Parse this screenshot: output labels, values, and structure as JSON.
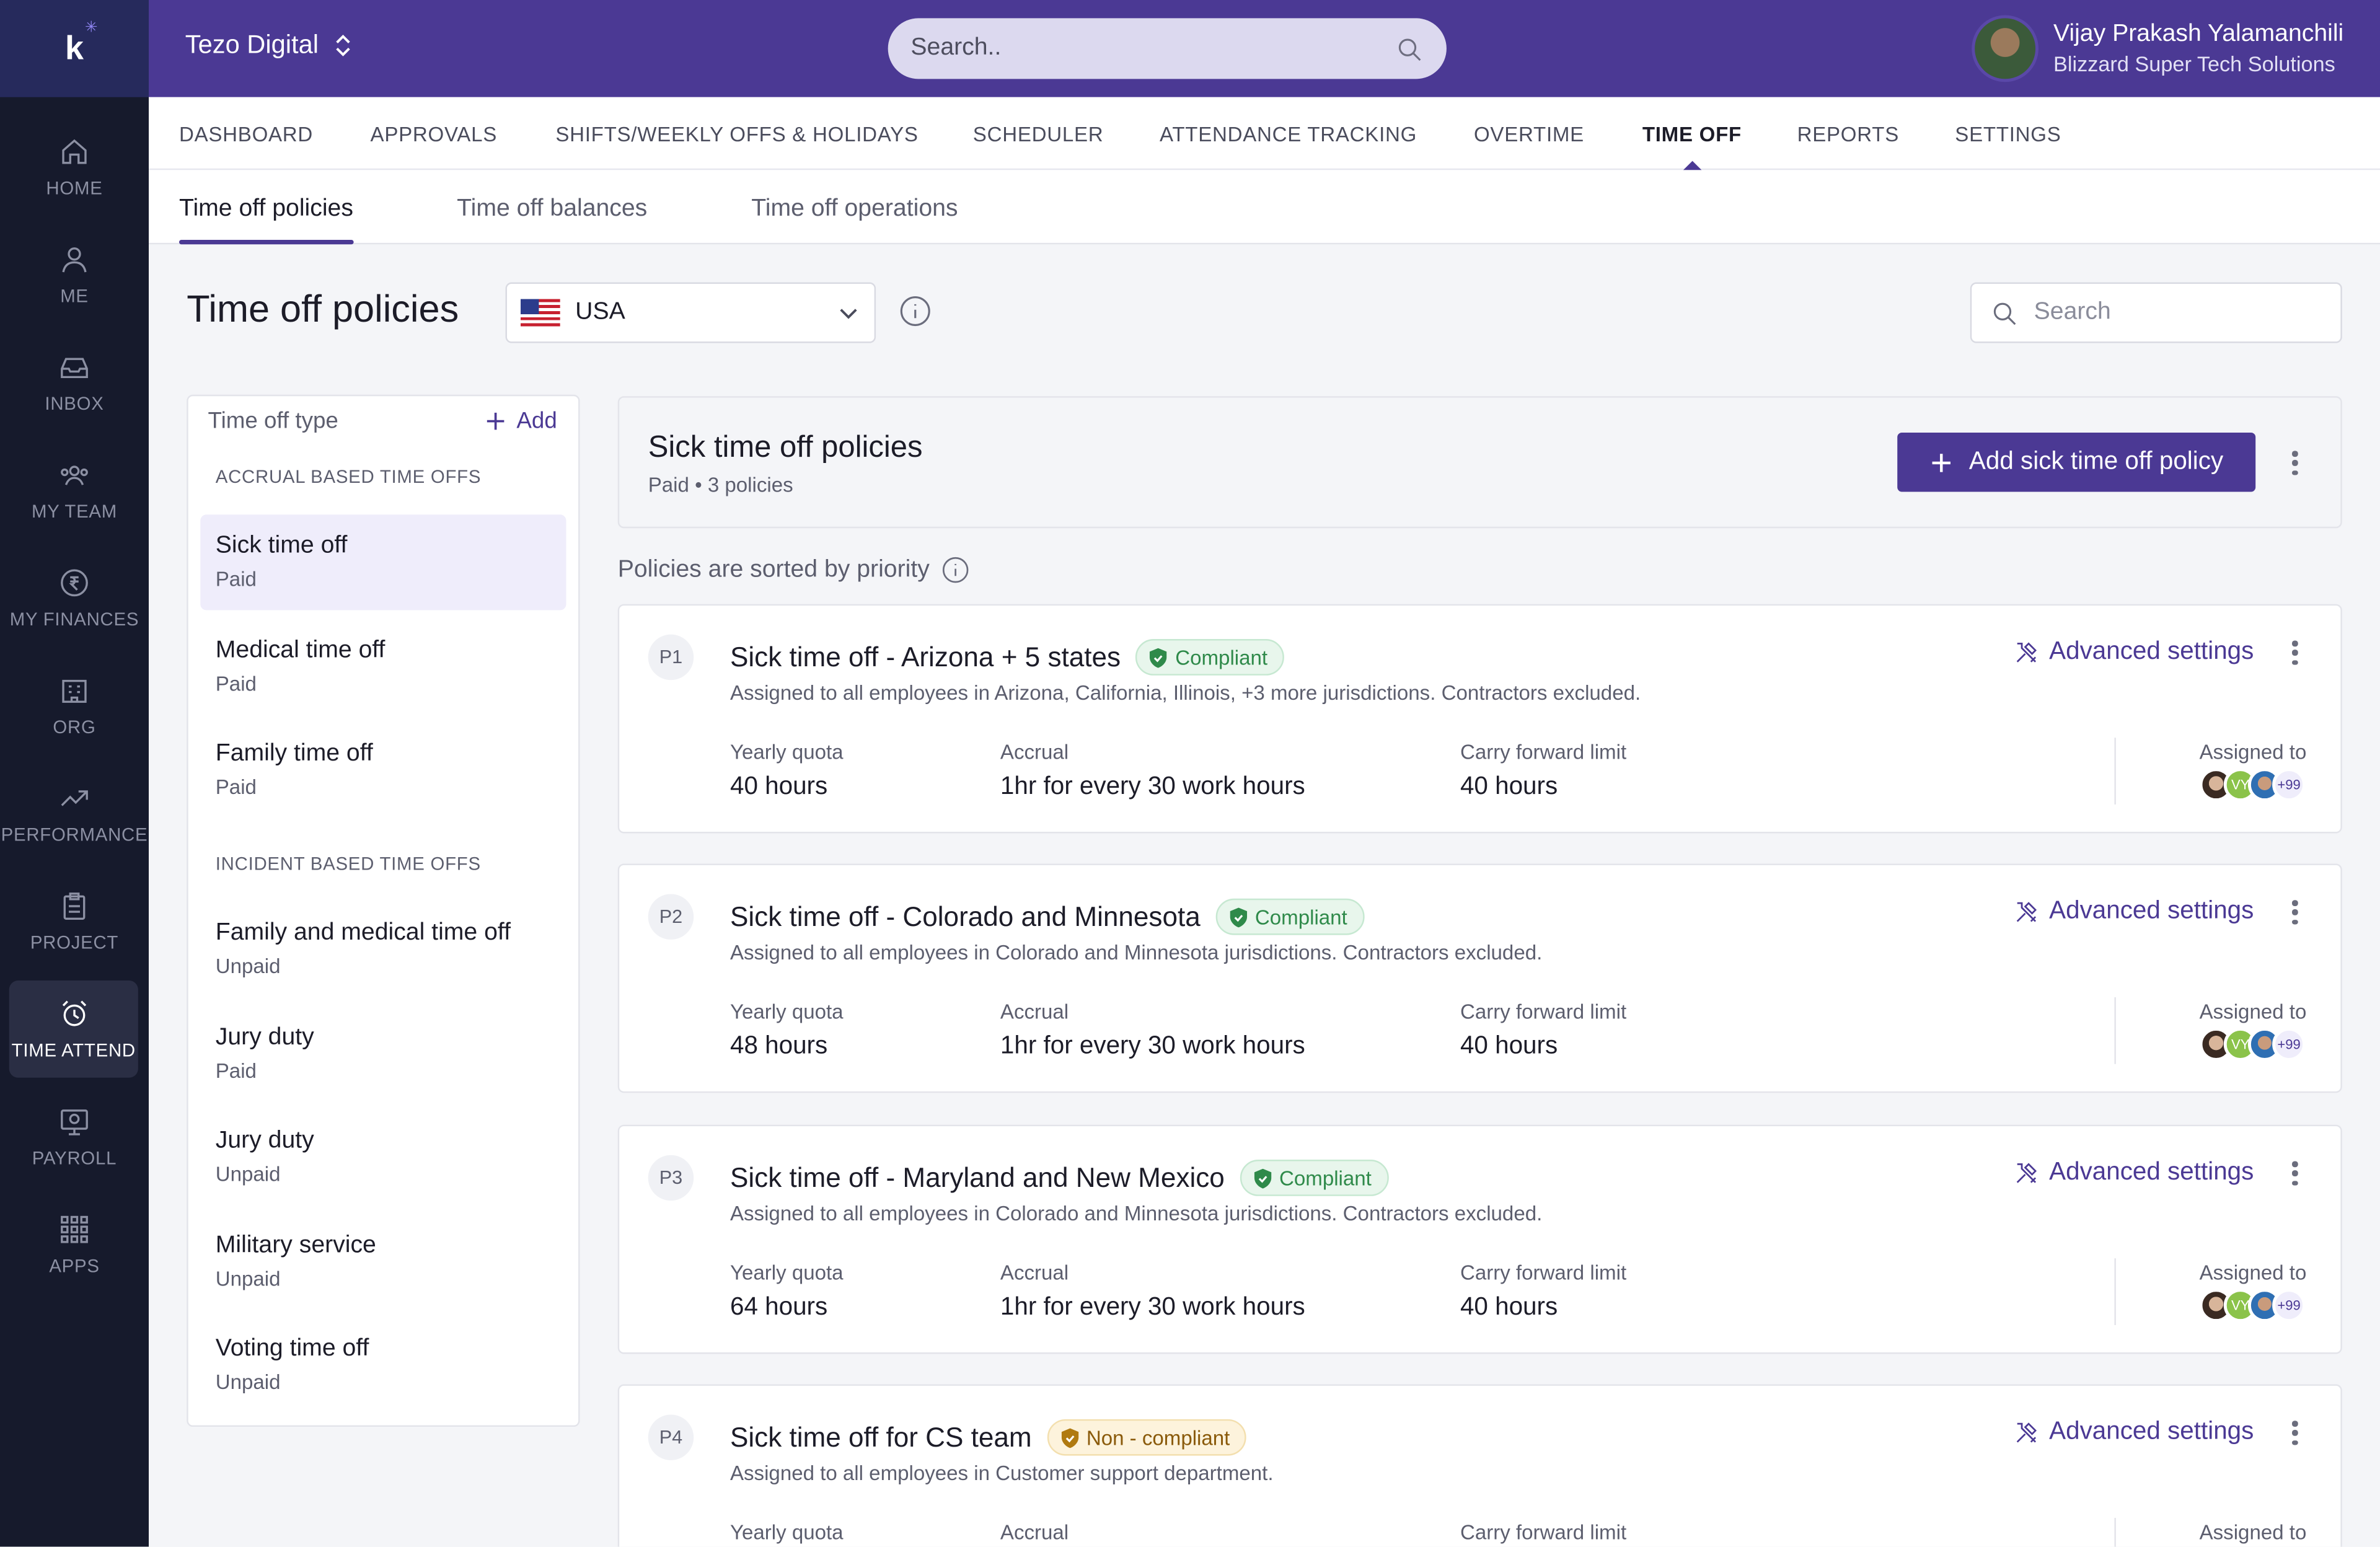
{
  "rail": {
    "items": [
      {
        "label": "HOME",
        "icon": "home-icon"
      },
      {
        "label": "ME",
        "icon": "user-icon"
      },
      {
        "label": "INBOX",
        "icon": "inbox-icon"
      },
      {
        "label": "MY TEAM",
        "icon": "team-icon"
      },
      {
        "label": "MY FINANCES",
        "icon": "rupee-icon"
      },
      {
        "label": "ORG",
        "icon": "building-icon"
      },
      {
        "label": "PERFORMANCE",
        "icon": "trend-icon"
      },
      {
        "label": "PROJECT",
        "icon": "clipboard-icon"
      },
      {
        "label": "TIME ATTEND",
        "icon": "alarm-icon"
      },
      {
        "label": "PAYROLL",
        "icon": "payroll-icon"
      },
      {
        "label": "APPS",
        "icon": "apps-icon"
      }
    ]
  },
  "topbar": {
    "org": "Tezo Digital",
    "search_placeholder": "Search..",
    "user_name": "Vijay Prakash Yalamanchili",
    "user_company": "Blizzard Super Tech Solutions"
  },
  "modules": [
    "DASHBOARD",
    "APPROVALS",
    "SHIFTS/WEEKLY OFFS & HOLIDAYS",
    "SCHEDULER",
    "ATTENDANCE TRACKING",
    "OVERTIME",
    "TIME OFF",
    "REPORTS",
    "SETTINGS"
  ],
  "subtabs": [
    "Time off policies",
    "Time off balances",
    "Time off operations"
  ],
  "page": {
    "title": "Time off policies",
    "country": "USA",
    "search_placeholder": "Search"
  },
  "types_panel": {
    "header": "Time off type",
    "add": "Add",
    "sections": [
      {
        "label": "ACCRUAL BASED TIME OFFS",
        "items": [
          {
            "title": "Sick time off",
            "sub": "Paid"
          },
          {
            "title": "Medical time off",
            "sub": "Paid"
          },
          {
            "title": "Family time off",
            "sub": "Paid"
          }
        ]
      },
      {
        "label": "INCIDENT BASED TIME OFFS",
        "items": [
          {
            "title": "Family and medical time off",
            "sub": "Unpaid"
          },
          {
            "title": "Jury duty",
            "sub": "Paid"
          },
          {
            "title": "Jury duty",
            "sub": "Unpaid"
          },
          {
            "title": "Military service",
            "sub": "Unpaid"
          },
          {
            "title": "Voting time off",
            "sub": "Unpaid"
          }
        ]
      }
    ]
  },
  "policy_header": {
    "title": "Sick time off policies",
    "meta": "Paid • 3 policies",
    "add_button": "Add sick time off policy"
  },
  "sorted_note": "Policies are sorted by priority",
  "labels": {
    "advanced": "Advanced settings",
    "yearly": "Yearly quota",
    "accrual": "Accrual",
    "carry": "Carry forward limit",
    "assigned": "Assigned to",
    "more": "+99"
  },
  "policies": [
    {
      "priority": "P1",
      "title": "Sick time off - Arizona + 5 states",
      "status": "Compliant",
      "desc": "Assigned to all employees in Arizona, California, Illinois, +3 more jurisdictions. Contractors excluded.",
      "yearly": "40 hours",
      "accrual": "1hr for every 30 work hours",
      "carry": "40 hours"
    },
    {
      "priority": "P2",
      "title": "Sick time off - Colorado and Minnesota",
      "status": "Compliant",
      "desc": "Assigned to all employees in Colorado and Minnesota jurisdictions. Contractors excluded.",
      "yearly": "48 hours",
      "accrual": "1hr for every 30 work hours",
      "carry": "40 hours"
    },
    {
      "priority": "P3",
      "title": "Sick time off - Maryland and New Mexico",
      "status": "Compliant",
      "desc": "Assigned to all employees in Colorado and Minnesota jurisdictions. Contractors excluded.",
      "yearly": "64 hours",
      "accrual": "1hr for every 30 work hours",
      "carry": "40 hours"
    },
    {
      "priority": "P4",
      "title": "Sick time off for CS team",
      "status": "Non - compliant",
      "desc": "Assigned to all employees in Customer support department.",
      "yearly": "",
      "accrual": "",
      "carry": ""
    }
  ],
  "colors": {
    "brand": "#4b3994",
    "rail": "#161a2c",
    "compliant": "#2f8a4a",
    "noncompliant": "#8a5a0a"
  }
}
